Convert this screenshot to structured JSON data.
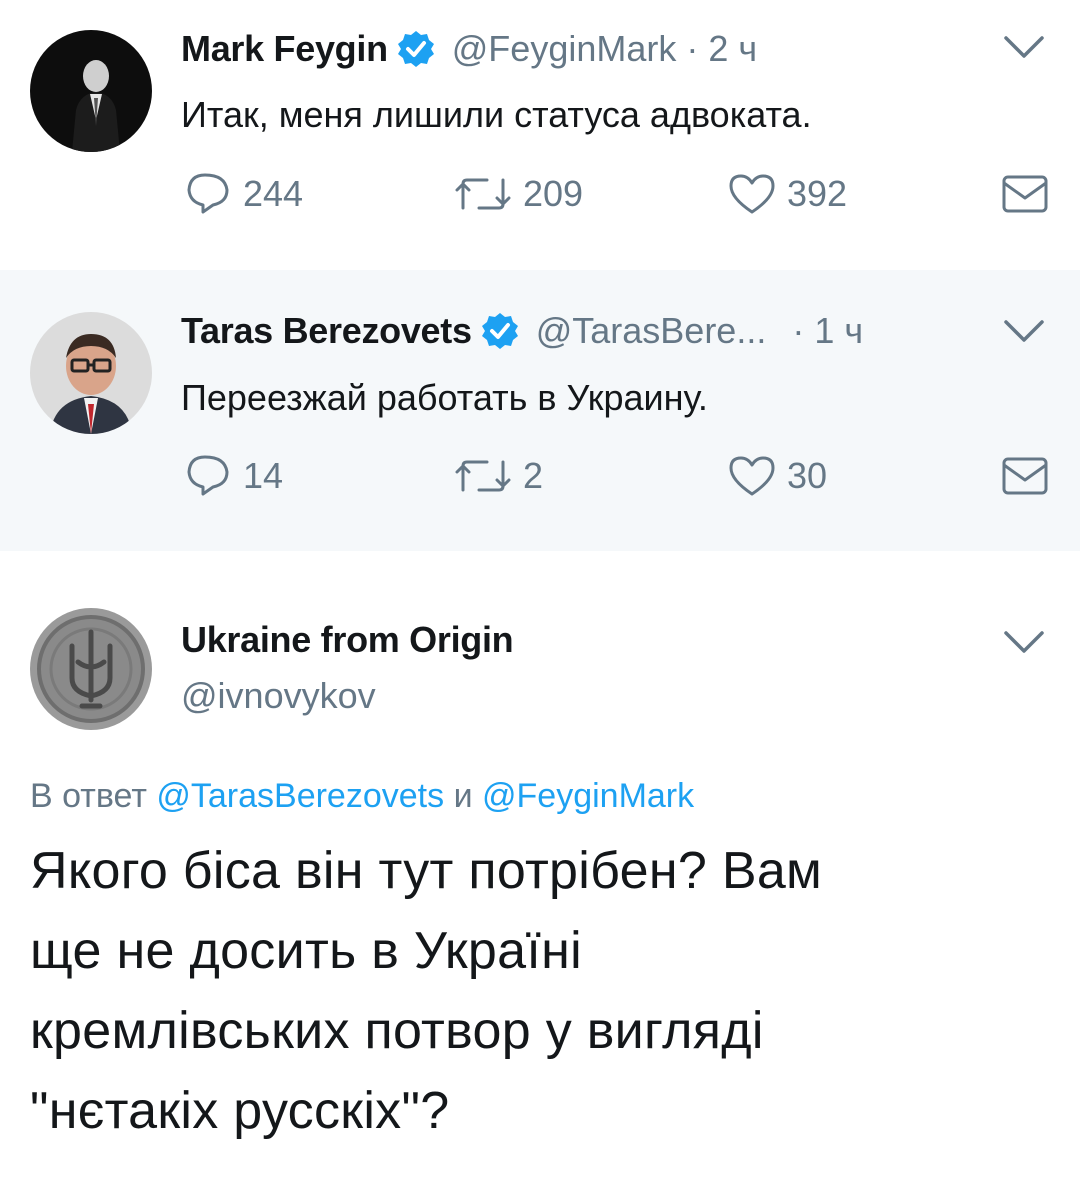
{
  "tweets": [
    {
      "name": "Mark Feygin",
      "verified": true,
      "handle": "@FeyginMark",
      "separator": "·",
      "time": "2 ч",
      "text": "Итак, меня лишили статуса адвоката.",
      "replies": "244",
      "retweets": "209",
      "likes": "392"
    },
    {
      "name": "Taras Berezovets",
      "verified": true,
      "handle": "@TarasBere...",
      "separator": "·",
      "time": "1 ч",
      "text": "Переезжай работать в Украину.",
      "replies": "14",
      "retweets": "2",
      "likes": "30"
    }
  ],
  "main_tweet": {
    "name": "Ukraine from Origin",
    "handle": "@ivnovykov",
    "reply_prefix": "В ответ",
    "reply_user_1": "@TarasBerezovets",
    "reply_and": "и",
    "reply_user_2": "@FeyginMark",
    "text_lines": [
      "Якого біса він тут потрібен? Вам",
      "ще не досить в Україні",
      "кремлівських потвор у вигляді",
      "\"нєтакіх русскіх\"?"
    ]
  },
  "colors": {
    "accent": "#1da1f2",
    "secondary_text": "#657786",
    "highlight_bg": "#f5f8fa",
    "thread_line": "#ccd6dd"
  },
  "icons": [
    "verified-badge-icon",
    "chevron-down-icon",
    "reply-icon",
    "retweet-icon",
    "like-icon",
    "direct-message-icon"
  ]
}
